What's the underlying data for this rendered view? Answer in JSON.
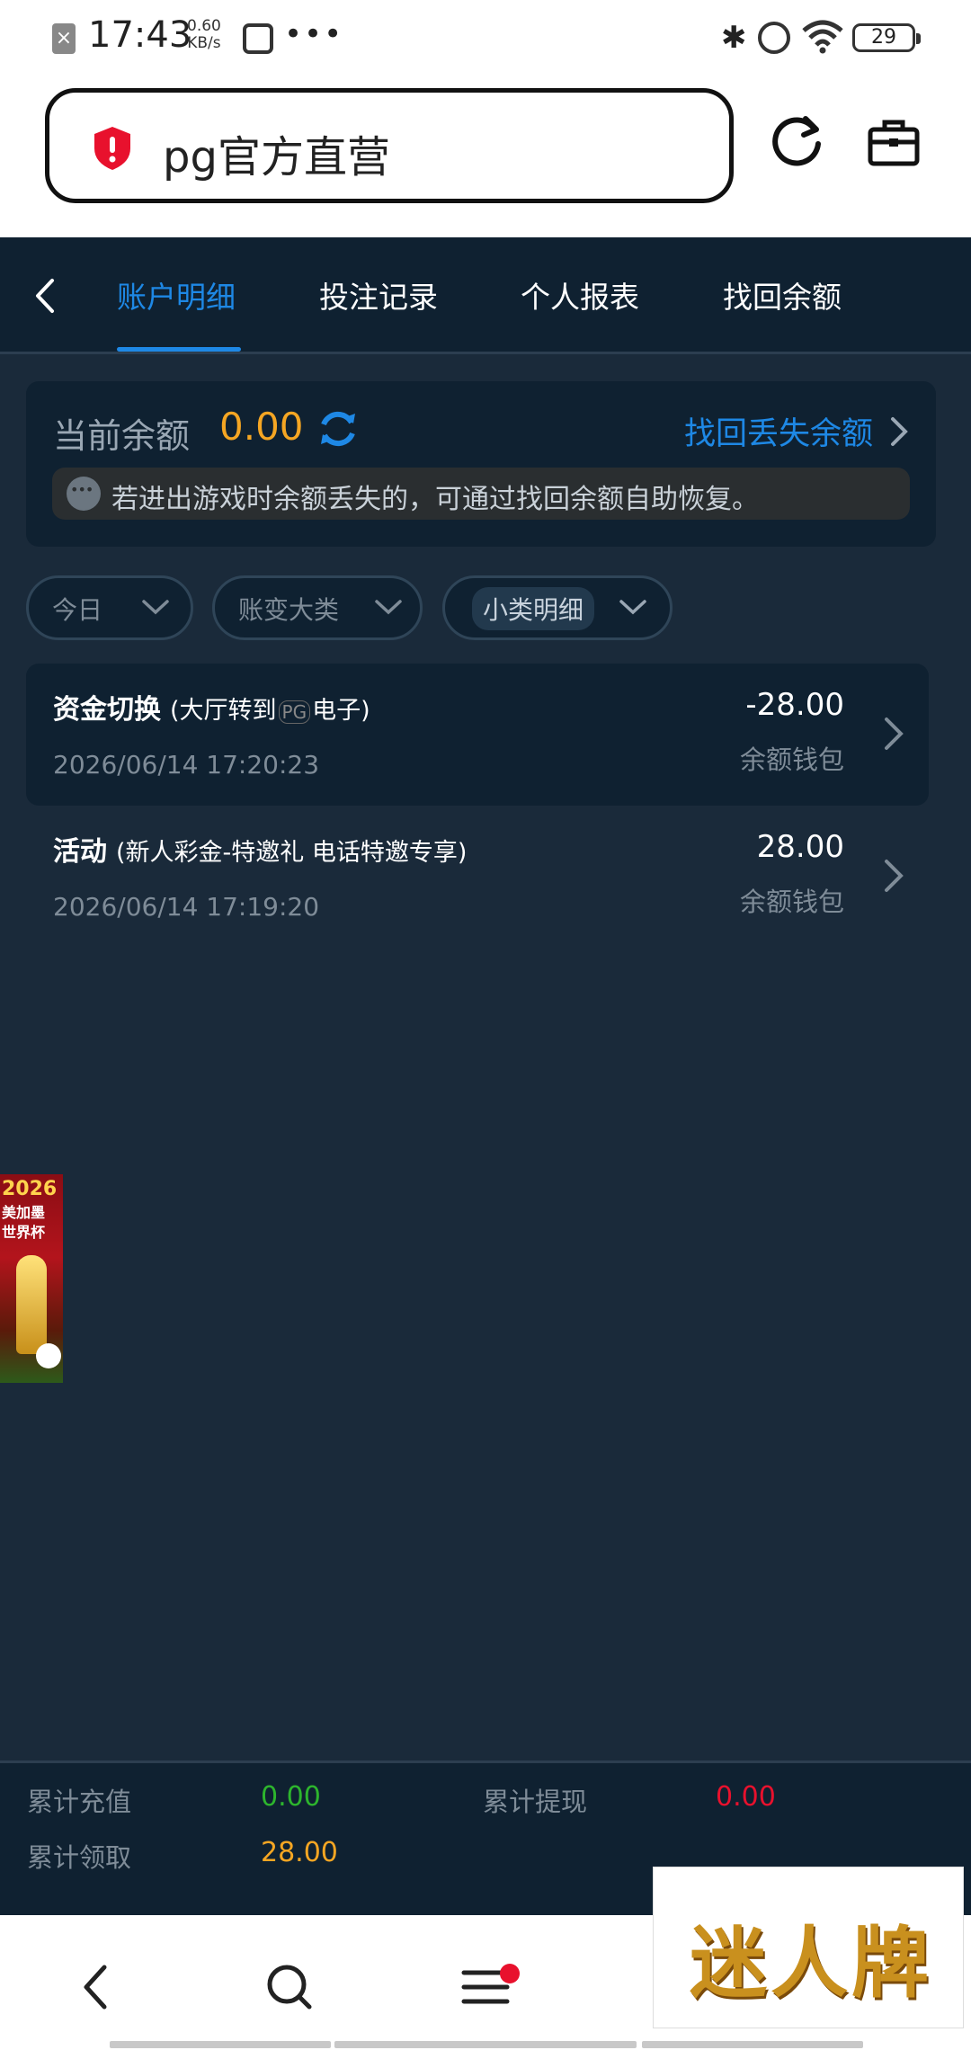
{
  "status_bar": {
    "time": "17:43",
    "net_speed_value": "0.60",
    "net_speed_unit": "KB/s",
    "battery": "29"
  },
  "address_bar": {
    "url_text": "pg官方直营"
  },
  "tabs": [
    {
      "label": "账户明细",
      "active": true
    },
    {
      "label": "投注记录",
      "active": false
    },
    {
      "label": "个人报表",
      "active": false
    },
    {
      "label": "找回余额",
      "active": false
    }
  ],
  "balance": {
    "label": "当前余额",
    "value": "0.00",
    "recover_link": "找回丢失余额",
    "notice": "若进出游戏时余额丢失的，可通过找回余额自助恢复。"
  },
  "filters": [
    {
      "label": "今日"
    },
    {
      "label": "账变大类"
    },
    {
      "label": "小类明细"
    }
  ],
  "transactions": [
    {
      "title": "资金切换",
      "subtitle_pre": "(大厅转到",
      "subtitle_logo": "PG",
      "subtitle_post": "电子)",
      "date": "2026/06/14 17:20:23",
      "amount": "-28.00",
      "wallet": "余额钱包"
    },
    {
      "title": "活动",
      "subtitle": "(新人彩金-特邀礼 电话特邀专享)",
      "date": "2026/06/14 17:19:20",
      "amount": "28.00",
      "wallet": "余额钱包"
    }
  ],
  "promo_banner": {
    "year": "2026",
    "line1": "美加墨",
    "line2": "世界杯"
  },
  "totals": {
    "recharge_label": "累计充值",
    "recharge_value": "0.00",
    "withdraw_label": "累计提现",
    "withdraw_value": "0.00",
    "claimed_label": "累计领取",
    "claimed_value": "28.00"
  },
  "ad_badge": {
    "text": "迷人牌"
  },
  "colors": {
    "accent": "#1e88e5",
    "balance": "#f5a623",
    "positive": "#2db52d",
    "negative": "#e8112d",
    "background": "#1a2a3a",
    "panel": "#0f2131"
  }
}
